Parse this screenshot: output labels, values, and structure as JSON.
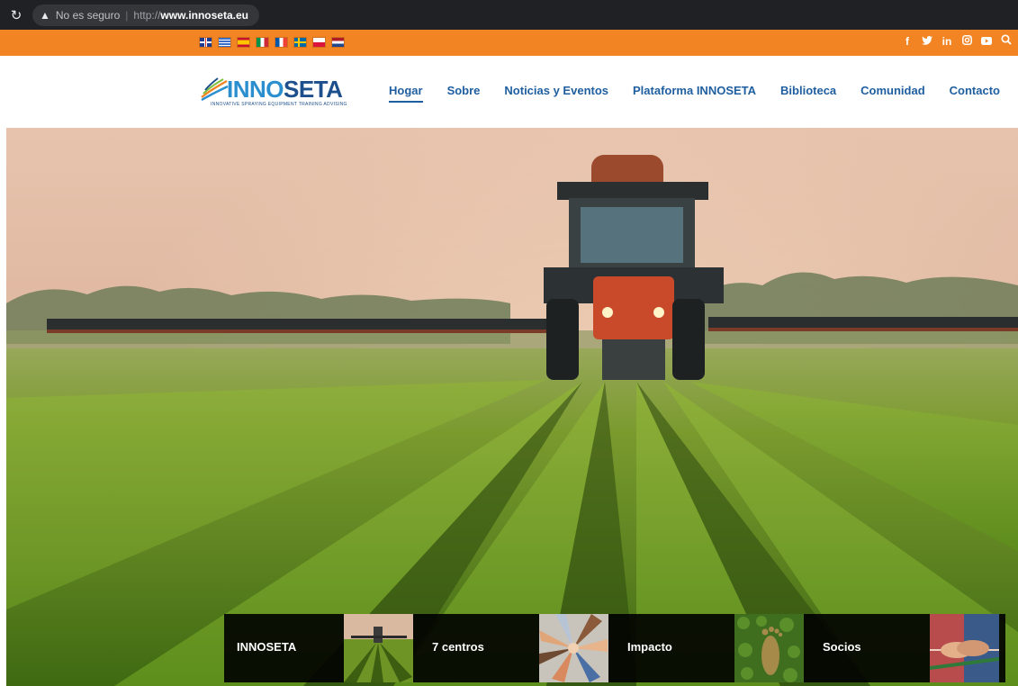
{
  "browser": {
    "reload_icon": "reload-icon",
    "warning_icon": "warning-triangle-icon",
    "security_text": "No es seguro",
    "protocol": "http://",
    "host": "www.innoseta.eu"
  },
  "topbar": {
    "flags": [
      "en",
      "gr",
      "es",
      "it",
      "fr",
      "se",
      "pl",
      "nl"
    ],
    "social_icons": [
      "facebook-icon",
      "twitter-icon",
      "linkedin-icon",
      "instagram-icon",
      "youtube-icon",
      "search-icon"
    ],
    "color": "#f28423"
  },
  "logo": {
    "name_part1": "INNO",
    "name_part2": "SETA",
    "tagline": "INNOVATIVE SPRAYING EQUIPMENT TRAINING ADVISING"
  },
  "nav": {
    "items": [
      {
        "label": "Hogar",
        "active": true
      },
      {
        "label": "Sobre"
      },
      {
        "label": "Noticias y Eventos"
      },
      {
        "label": "Plataforma INNOSETA"
      },
      {
        "label": "Biblioteca"
      },
      {
        "label": "Comunidad"
      },
      {
        "label": "Contacto"
      }
    ],
    "color": "#1f5fa0"
  },
  "cards": [
    {
      "label": "INNOSETA",
      "thumb": "tractor-field-thumb"
    },
    {
      "label": "7 centros",
      "thumb": "hands-circle-thumb"
    },
    {
      "label": "Impacto",
      "thumb": "footprint-thumb"
    },
    {
      "label": "Socios",
      "thumb": "handshake-thumb"
    }
  ]
}
